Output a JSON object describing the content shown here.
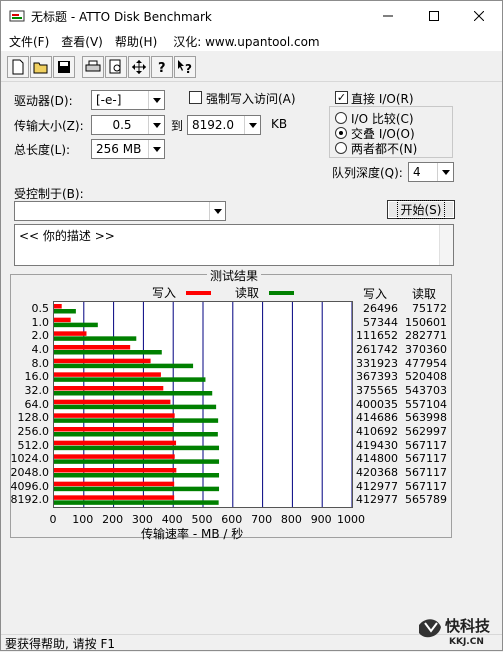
{
  "window": {
    "title": "无标题 - ATTO Disk Benchmark"
  },
  "menu": {
    "file": "文件(F)",
    "view": "查看(V)",
    "help": "帮助(H)",
    "sinicized": "汉化: www.upantool.com"
  },
  "toolbar": {
    "buttons": [
      "new-file-icon",
      "open-folder-icon",
      "save-icon",
      "print-icon",
      "print-preview-icon",
      "move-icon",
      "help-icon",
      "context-help-icon"
    ]
  },
  "form": {
    "drive_label": "驱动器(D):",
    "drive_value": "[-e-]",
    "force_write_label": "强制写入访问(A)",
    "direct_io_label": "直接 I/O(R)",
    "transfer_label": "传输大小(Z):",
    "transfer_from": "0.5",
    "to_label": "到",
    "transfer_to": "8192.0",
    "kb_label": "KB",
    "total_label": "总长度(L):",
    "total_value": "256 MB",
    "io_compare_label": "I/O 比较(C)",
    "overlapped_io_label": "交叠 I/O(O)",
    "neither_label": "两者都不(N)",
    "queue_label": "队列深度(Q):",
    "queue_value": "4",
    "controlled_label": "受控制于(B):",
    "controlled_value": "",
    "start_label": "开始(S)",
    "description": "<<  你的描述  >>"
  },
  "results": {
    "title": "测试结果",
    "write_legend": "写入",
    "read_legend": "读取",
    "write_col": "写入",
    "read_col": "读取",
    "x_title": "传输速率 - MB / 秒"
  },
  "status": {
    "text": "要获得帮助, 请按 F1"
  },
  "colors": {
    "write": "#ff0000",
    "read": "#008000"
  },
  "chart_data": {
    "type": "bar",
    "categories": [
      "0.5",
      "1.0",
      "2.0",
      "4.0",
      "8.0",
      "16.0",
      "32.0",
      "64.0",
      "128.0",
      "256.0",
      "512.0",
      "1024.0",
      "2048.0",
      "4096.0",
      "8192.0"
    ],
    "series": [
      {
        "name": "写入",
        "values": [
          26496,
          57344,
          111652,
          261742,
          331923,
          367393,
          375565,
          400035,
          414686,
          410692,
          419430,
          414800,
          420368,
          412977,
          412977
        ]
      },
      {
        "name": "读取",
        "values": [
          75172,
          150601,
          282771,
          370360,
          477954,
          520408,
          543703,
          557104,
          563998,
          562997,
          567117,
          567117,
          567117,
          567117,
          565789
        ]
      }
    ],
    "xlabel": "传输速率 - MB / 秒",
    "xticks": [
      "0",
      "100",
      "200",
      "300",
      "400",
      "500",
      "600",
      "700",
      "800",
      "900",
      "1000"
    ],
    "xlim": [
      0,
      1000
    ],
    "grid": true
  }
}
